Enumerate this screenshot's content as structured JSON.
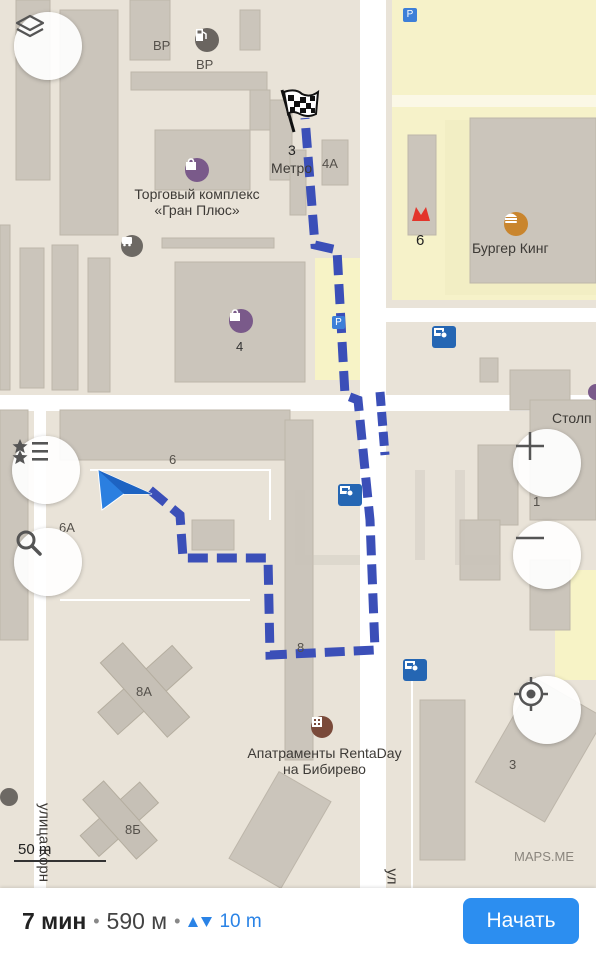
{
  "map": {
    "buildings": {
      "vr_small": "ВР",
      "vr_gas": "ВР",
      "metro_number": "3",
      "metro_label": "Метро",
      "b4a": "4А",
      "mall_name": "Торговый комплекс «Гран Плюс»",
      "b6_metro": "6",
      "burger_king": "Бургер Кинг",
      "b4": "4",
      "stolp": "Столп",
      "b6": "6",
      "b6a": "6А",
      "b1": "1",
      "b8": "8",
      "b8a": "8А",
      "hotel_name": "Апатраменты RentaDay на Бибирево",
      "b3": "3",
      "b8b": "8Б",
      "parking_top": "P",
      "parking_mid": "P",
      "street_left": "улица Корн",
      "street_right": "ул"
    },
    "icons": {
      "layers": "layers-icon",
      "bookmarks": "bookmarks-list-icon",
      "search": "search-icon",
      "zoom_in": "plus-icon",
      "zoom_out": "minus-icon",
      "locate": "my-location-icon",
      "finish": "checkered-flag-icon",
      "position": "navigation-arrow-icon"
    },
    "scale_label": "50 m",
    "watermark": "MAPS.ME",
    "route_color": "#3b4fb8",
    "accent": "#2c8ef0"
  },
  "route": {
    "time": "7 мин",
    "distance": "590 м",
    "elevation": "10 m",
    "start_label": "Начать"
  }
}
